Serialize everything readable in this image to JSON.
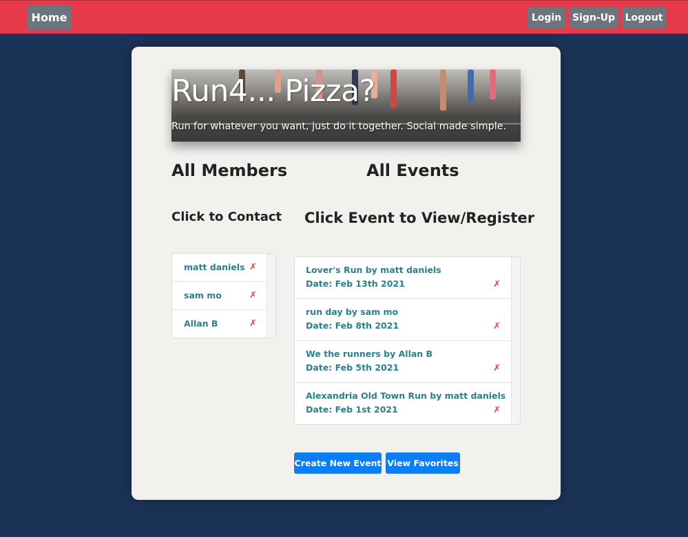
{
  "nav": {
    "home_label": "Home",
    "login_label": "Login",
    "signup_label": "Sign-Up",
    "logout_label": "Logout",
    "bar_color": "#e63a4b"
  },
  "banner": {
    "title": "Run4... Pizza?",
    "subtitle": "Run for whatever you want, just do it together. Social made simple."
  },
  "members": {
    "heading": "All Members",
    "subheading": "Click to Contact",
    "items": [
      {
        "name": "matt daniels",
        "delete_icon": "✗"
      },
      {
        "name": "sam mo",
        "delete_icon": "✗"
      },
      {
        "name": "Allan B",
        "delete_icon": "✗"
      }
    ]
  },
  "events": {
    "heading": "All Events",
    "subheading": "Click Event to View/Register",
    "items": [
      {
        "title": "Lover's Run by matt daniels",
        "date": "Date: Feb 13th 2021",
        "delete_icon": "✗"
      },
      {
        "title": "run day by sam mo",
        "date": "Date: Feb 8th 2021",
        "delete_icon": "✗"
      },
      {
        "title": "We the runners by Allan B",
        "date": "Date: Feb 5th 2021",
        "delete_icon": "✗"
      },
      {
        "title": "Alexandria Old Town Run by matt daniels",
        "date": "Date: Feb 1st 2021",
        "delete_icon": "✗"
      }
    ]
  },
  "actions": {
    "create_label": "Create New Event",
    "favorites_label": "View Favorites",
    "accent_color": "#0a7df7"
  }
}
